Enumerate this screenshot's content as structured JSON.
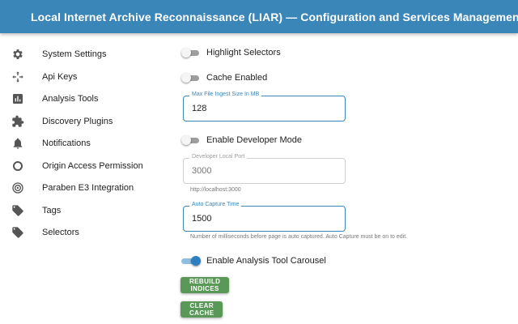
{
  "header": {
    "title": "Local Internet Archive Reconnaissance (LIAR) — Configuration and Services Management",
    "menu_icon": "hamburger-menu-icon"
  },
  "sidebar": {
    "items": [
      {
        "label": "System Settings",
        "icon": "gear-icon"
      },
      {
        "label": "Api Keys",
        "icon": "move-arrows-icon"
      },
      {
        "label": "Analysis Tools",
        "icon": "bar-chart-icon"
      },
      {
        "label": "Discovery Plugins",
        "icon": "puzzle-icon"
      },
      {
        "label": "Notifications",
        "icon": "bell-icon"
      },
      {
        "label": "Origin Access Permission",
        "icon": "ring-icon"
      },
      {
        "label": "Paraben E3 Integration",
        "icon": "target-icon"
      },
      {
        "label": "Tags",
        "icon": "tag-icon"
      },
      {
        "label": "Selectors",
        "icon": "tag-icon"
      }
    ]
  },
  "settings": {
    "highlight_selectors": {
      "label": "Highlight Selectors",
      "enabled": false
    },
    "cache_enabled": {
      "label": "Cache Enabled",
      "enabled": false
    },
    "max_file_ingest": {
      "label": "Max File Ingest Size In MB",
      "value": "128"
    },
    "developer_mode": {
      "label": "Enable Developer Mode",
      "enabled": false
    },
    "developer_port": {
      "label": "Developer Local Port",
      "placeholder": "3000",
      "helper": "http://localhost:3000",
      "disabled": true
    },
    "auto_capture_time": {
      "label": "Auto Capture Time",
      "value": "1500",
      "helper": "Number of milliseconds before page is auto captured. Auto Capture must be on to edit."
    },
    "analysis_carousel": {
      "label": "Enable Analysis Tool Carousel",
      "enabled": true
    }
  },
  "actions": {
    "rebuild_indices": "REBUILD INDICES",
    "clear_cache": "CLEAR CACHE"
  },
  "colors": {
    "appbar": "#3b86b9",
    "button": "#5a9858",
    "switch_on": "#2d7fc0",
    "icon": "#555555"
  }
}
